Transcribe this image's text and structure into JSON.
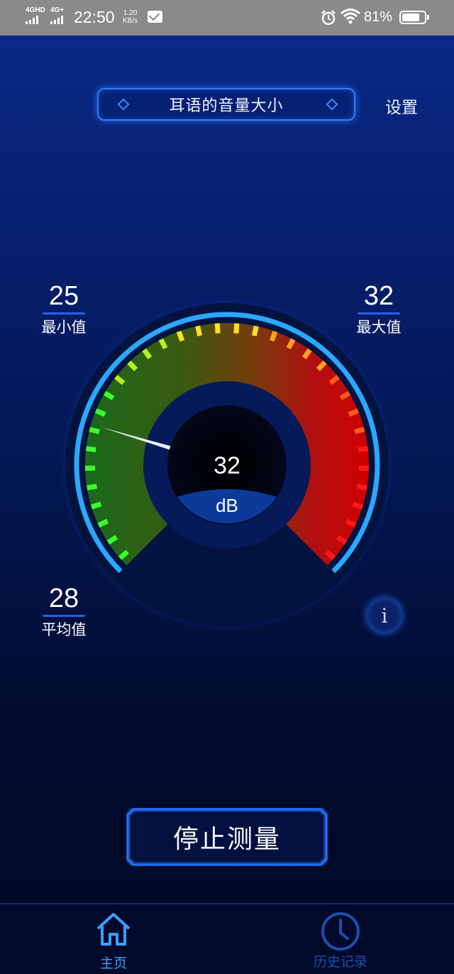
{
  "status_bar": {
    "sim1": "4GHD",
    "sim2": "4G+",
    "time": "22:50",
    "speed_value": "1.20",
    "speed_unit": "KB/s",
    "battery_percent": "81%",
    "battery_level": 0.81,
    "icons": [
      "signal-icon",
      "mail-icon",
      "alarm-icon",
      "wifi-icon",
      "battery-icon"
    ]
  },
  "header": {
    "mode_label": "耳语的音量大小",
    "settings_label": "设置"
  },
  "stats": {
    "min": {
      "value": "25",
      "label": "最小值"
    },
    "max": {
      "value": "32",
      "label": "最大值"
    },
    "avg": {
      "value": "28",
      "label": "平均值"
    }
  },
  "gauge": {
    "current_value": "32",
    "unit": "dB",
    "needle_value": 32,
    "scale_min": 0,
    "scale_max": 140
  },
  "info_button": {
    "label": "i"
  },
  "stop_button": {
    "label": "停止测量"
  },
  "tabbar": {
    "home_label": "主页",
    "history_label": "历史记录"
  },
  "colors": {
    "accent": "#2f7cff",
    "tab_active": "#3aa0ff",
    "tab_inactive": "#1e4fb0"
  }
}
